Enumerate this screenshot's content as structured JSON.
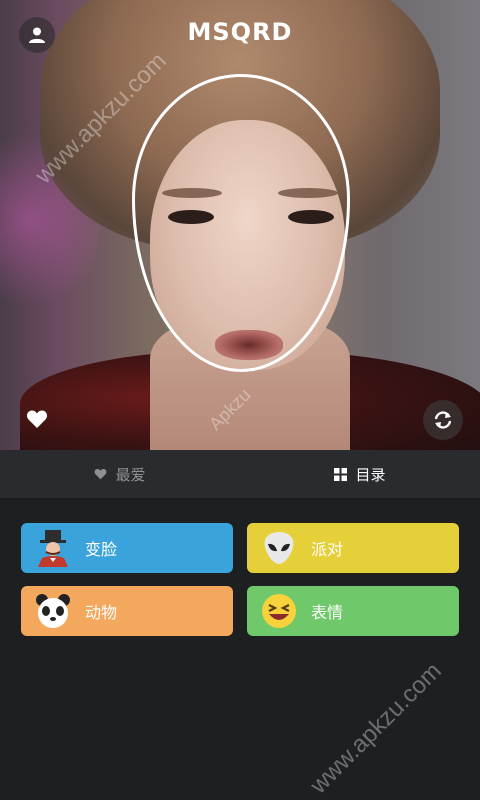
{
  "app": {
    "title": "MSQRD"
  },
  "watermark": {
    "text": "www.apkzu.com",
    "text2": "Apkzu"
  },
  "camera": {
    "icons": {
      "profile": "person-icon",
      "favorite": "heart-icon",
      "switch_camera": "camera-switch-icon"
    }
  },
  "tabs": [
    {
      "label": "最爱",
      "icon": "heart-icon",
      "active": false
    },
    {
      "label": "目录",
      "icon": "grid-icon",
      "active": true
    }
  ],
  "categories": [
    {
      "label": "变脸",
      "icon": "magician-icon",
      "color": "#3aa3db"
    },
    {
      "label": "派对",
      "icon": "alien-icon",
      "color": "#e6d03a"
    },
    {
      "label": "动物",
      "icon": "panda-icon",
      "color": "#f4a85e"
    },
    {
      "label": "表情",
      "icon": "laughing-emoji-icon",
      "color": "#6fc96a"
    }
  ]
}
